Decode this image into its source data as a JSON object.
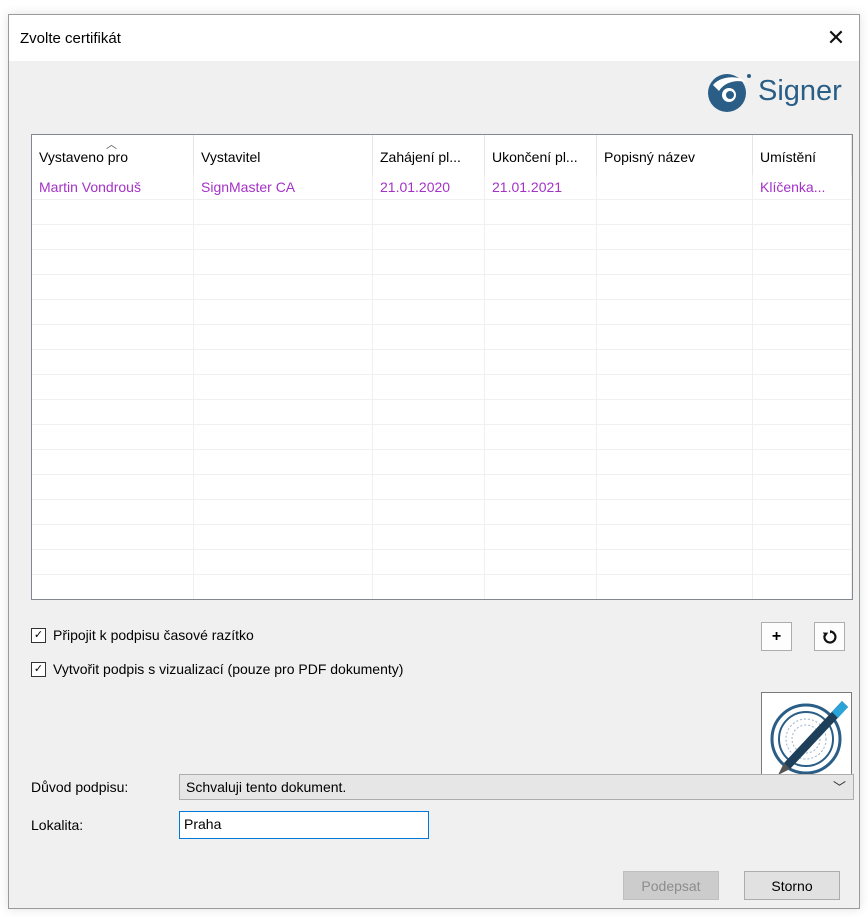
{
  "dialog": {
    "title": "Zvolte certifikát"
  },
  "logo": {
    "text": "Signer",
    "color": "#2a5e86"
  },
  "table": {
    "columns": [
      "Vystaveno pro",
      "Vystavitel",
      "Zahájení pl...",
      "Ukončení pl...",
      "Popisný název",
      "Umístění"
    ],
    "rows": [
      [
        "Martin Vondrouš",
        "SignMaster CA",
        "21.01.2020",
        "21.01.2021",
        "",
        "Klíčenka..."
      ]
    ],
    "row_text_color": "#a432c7"
  },
  "options": {
    "timestamp": {
      "label": "Připojit k podpisu časové razítko",
      "checked": true
    },
    "visualization": {
      "label": "Vytvořit podpis s vizualizací (pouze pro PDF dokumenty)",
      "checked": true
    }
  },
  "icons": {
    "add": "+",
    "refresh": "refresh-icon",
    "checkmark": "✓"
  },
  "form": {
    "reason_label": "Důvod podpisu:",
    "reason_value": "Schvaluji tento dokument.",
    "location_label": "Lokalita:",
    "location_value": "Praha"
  },
  "buttons": {
    "sign": "Podepsat",
    "cancel": "Storno"
  }
}
